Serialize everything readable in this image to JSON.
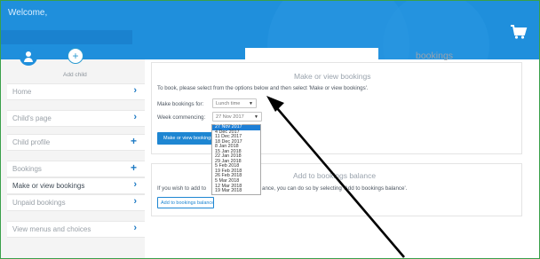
{
  "header": {
    "welcome": "Welcome,",
    "section_title": "bookings",
    "cart_icon": "shopping-cart-icon",
    "brand_color": "#1f8fdc"
  },
  "sidebar": {
    "add_child_label": "Add child",
    "items": [
      {
        "label": "Home",
        "icon": "chevron-right-icon"
      },
      {
        "label": "Child's page",
        "icon": "chevron-right-icon"
      },
      {
        "label": "Child profile",
        "icon": "plus-icon"
      },
      {
        "label": "Bookings",
        "icon": "plus-icon"
      },
      {
        "label": "Make or view bookings",
        "icon": "chevron-right-icon"
      },
      {
        "label": "Unpaid bookings",
        "icon": "chevron-right-icon"
      },
      {
        "label": "View menus and choices",
        "icon": "chevron-right-icon"
      }
    ]
  },
  "make_view": {
    "title": "Make or view bookings",
    "instructions": "To book, please select from the options below and then select 'Make or view bookings'.",
    "bookings_for_label": "Make bookings for:",
    "bookings_for_value": "Lunch time",
    "week_label": "Week commencing:",
    "week_value": "27 Nov 2017",
    "button_label": "Make or view bookings",
    "week_options": [
      "27 Nov 2017",
      "4 Dec 2017",
      "11 Dec 2017",
      "18 Dec 2017",
      "8 Jan 2018",
      "15 Jan 2018",
      "22 Jan 2018",
      "29 Jan 2018",
      "5 Feb 2018",
      "19 Feb 2018",
      "26 Feb 2018",
      "5 Mar 2018",
      "12 Mar 2018",
      "19 Mar 2018"
    ]
  },
  "balance": {
    "title": "Add to bookings balance",
    "text_before": "If you wish to add to",
    "text_after": "ance, you can do so by selecting 'Add to bookings balance'.",
    "button_label": "Add to bookings balance"
  }
}
